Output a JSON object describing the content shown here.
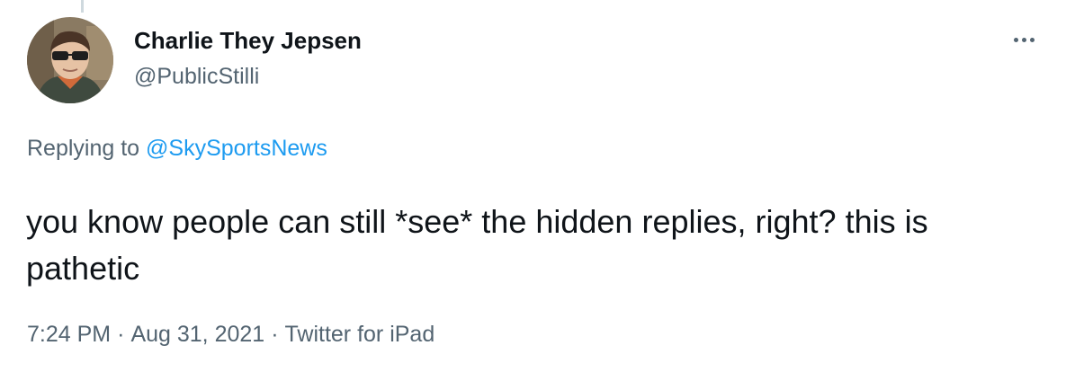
{
  "author": {
    "display_name": "Charlie They Jepsen",
    "handle": "@PublicStilli"
  },
  "reply": {
    "prefix": "Replying to",
    "target": "@SkySportsNews"
  },
  "tweet": {
    "text": "you know people can still *see* the hidden replies, right? this is pathetic"
  },
  "meta": {
    "time": "7:24 PM",
    "date": "Aug 31, 2021",
    "source": "Twitter for iPad",
    "separator": "·"
  },
  "icons": {
    "more": "more-options-icon"
  },
  "colors": {
    "text": "#0f1419",
    "secondary": "#536471",
    "link": "#1d9bf0"
  }
}
